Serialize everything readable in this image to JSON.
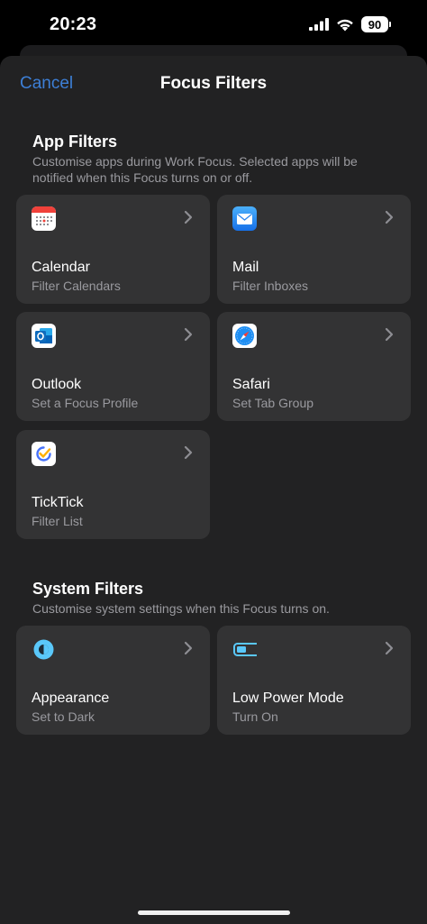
{
  "status_bar": {
    "time": "20:23",
    "battery_percent": "90",
    "cellular_icon": "signal-bars-icon",
    "wifi_icon": "wifi-icon"
  },
  "nav": {
    "cancel_label": "Cancel",
    "title": "Focus Filters"
  },
  "app_filters": {
    "title": "App Filters",
    "description": "Customise apps during Work Focus. Selected apps will be notified when this Focus turns on or off.",
    "tiles": [
      {
        "title": "Calendar",
        "subtitle": "Filter Calendars",
        "icon": "calendar-icon"
      },
      {
        "title": "Mail",
        "subtitle": "Filter Inboxes",
        "icon": "mail-icon"
      },
      {
        "title": "Outlook",
        "subtitle": "Set a Focus Profile",
        "icon": "outlook-icon"
      },
      {
        "title": "Safari",
        "subtitle": "Set Tab Group",
        "icon": "safari-icon"
      },
      {
        "title": "TickTick",
        "subtitle": "Filter List",
        "icon": "ticktick-icon"
      }
    ]
  },
  "system_filters": {
    "title": "System Filters",
    "description": "Customise system settings when this Focus turns on.",
    "tiles": [
      {
        "title": "Appearance",
        "subtitle": "Set to Dark",
        "icon": "appearance-icon"
      },
      {
        "title": "Low Power Mode",
        "subtitle": "Turn On",
        "icon": "battery-icon"
      }
    ]
  },
  "colors": {
    "accent": "#3d7fd6",
    "sheet_background": "#222223",
    "tile_background": "#333334",
    "secondary_text": "#9a9a9f",
    "system_icon": "#5ac8fa"
  }
}
